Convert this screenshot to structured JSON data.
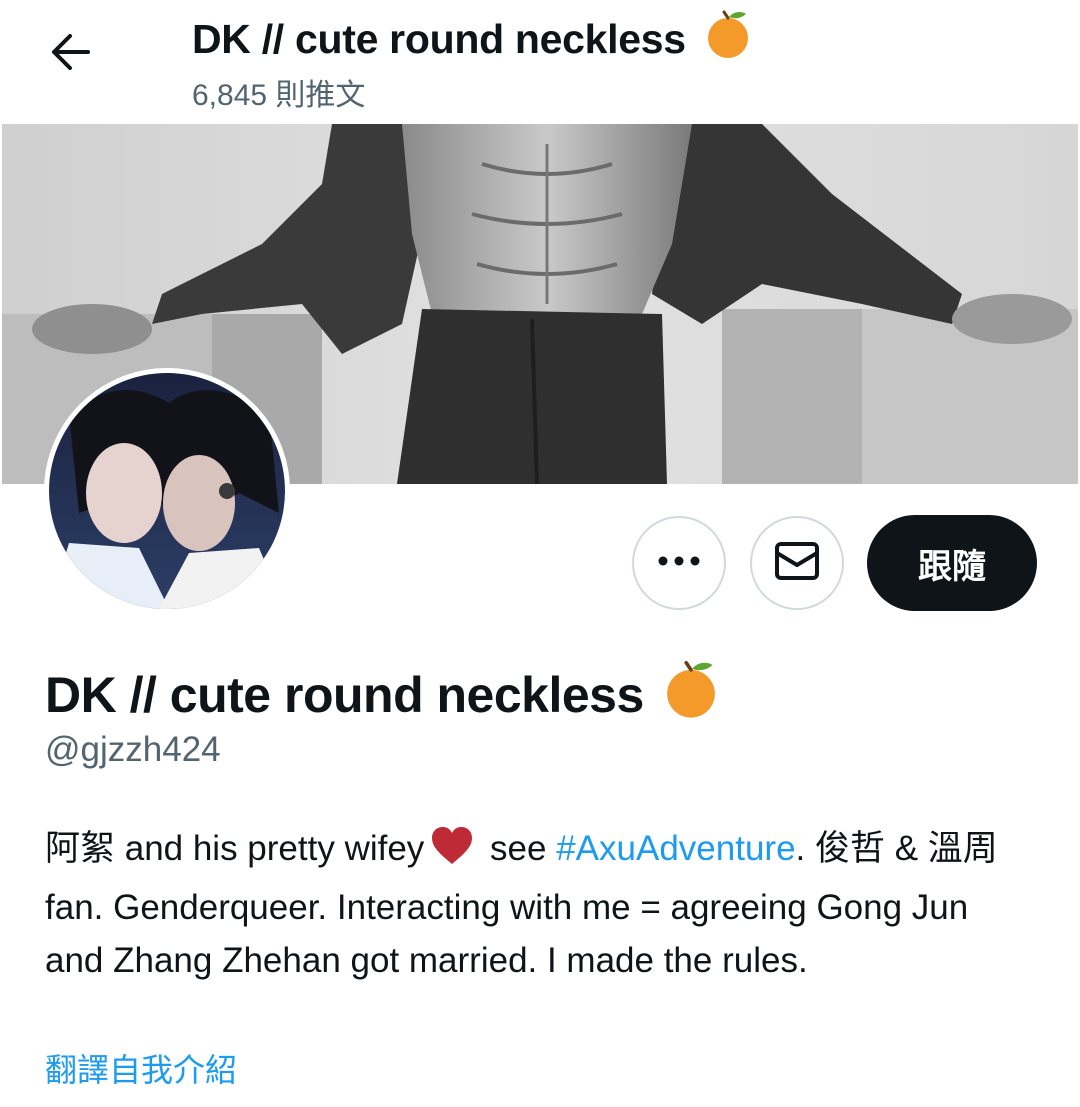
{
  "header": {
    "title": "DK // cute round neckless",
    "post_count": "6,845 則推文"
  },
  "icons": {
    "back": "back-arrow-icon",
    "more": "more-dots-icon",
    "mail": "envelope-icon",
    "name_emoji": "orange-emoji-icon",
    "bio_emoji": "red-heart-icon"
  },
  "actions": {
    "follow_label": "跟隨"
  },
  "profile": {
    "display_name": "DK // cute round neckless",
    "handle": "@gjzzh424",
    "bio": {
      "part1": "阿絮 and his pretty wifey",
      "part2": " see ",
      "hashtag": "#AxuAdventure",
      "part3": ". 俊哲 & 溫周 fan. Genderqueer. Interacting with me = agreeing Gong Jun and Zhang Zhehan got married. I made the rules."
    },
    "translate_label": "翻譯自我介紹"
  },
  "colors": {
    "text": "#0f1419",
    "secondary": "#536471",
    "link": "#1d9bf0",
    "button_dark": "#0f1419",
    "border": "#cfd9de"
  }
}
